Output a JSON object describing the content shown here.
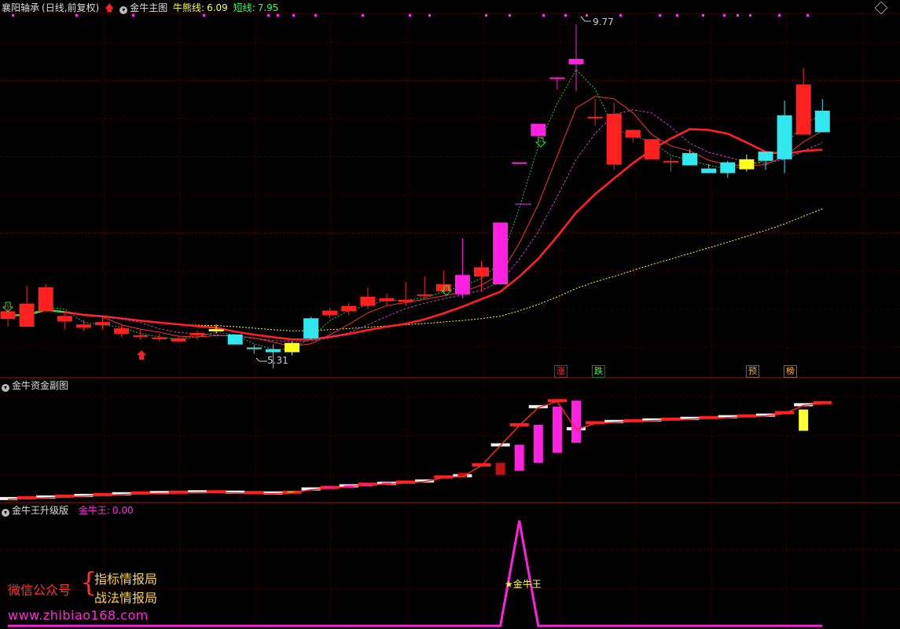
{
  "main_panel": {
    "stock_name": "襄阳轴承",
    "period": "(日线,前复权)",
    "indicator_name": "金牛主图",
    "bull_line_label": "牛熊线:",
    "bull_line_value": "6.09",
    "short_line_label": "短线:",
    "short_line_value": "7.95",
    "high_label": "9.77",
    "low_label": "5.31",
    "markers": [
      "涨",
      "跌",
      "预",
      "榜"
    ]
  },
  "sub_panel_1": {
    "title": "金牛资金副图"
  },
  "sub_panel_2": {
    "title": "金牛王升级版",
    "value_label": "金牛王:",
    "value": "0.00",
    "peak_label": "★金牛王"
  },
  "watermark": {
    "label": "微信公众号",
    "line1": "指标情报局",
    "line2": "战法情报局",
    "url": "www.zhibiao168.com"
  },
  "colors": {
    "up": "#ff2020",
    "down": "#30e8f0",
    "magenta": "#ff20e0",
    "yellow": "#ffff20",
    "grid": "#600000"
  },
  "chart_data": {
    "type": "candlestick",
    "candles": [
      {
        "o": 6.05,
        "c": 5.95,
        "h": 6.15,
        "l": 5.85,
        "color": "red"
      },
      {
        "o": 5.85,
        "c": 6.15,
        "h": 6.38,
        "l": 5.85,
        "color": "red"
      },
      {
        "o": 6.05,
        "c": 6.36,
        "h": 6.4,
        "l": 6.05,
        "color": "red"
      },
      {
        "o": 5.99,
        "c": 5.92,
        "h": 6.05,
        "l": 5.82,
        "color": "red"
      },
      {
        "o": 5.88,
        "c": 5.84,
        "h": 5.94,
        "l": 5.8,
        "color": "red"
      },
      {
        "o": 5.87,
        "c": 5.91,
        "h": 5.98,
        "l": 5.82,
        "color": "red"
      },
      {
        "o": 5.83,
        "c": 5.76,
        "h": 5.88,
        "l": 5.72,
        "color": "red"
      },
      {
        "o": 5.74,
        "c": 5.72,
        "h": 5.82,
        "l": 5.68,
        "color": "red"
      },
      {
        "o": 5.71,
        "c": 5.7,
        "h": 5.76,
        "l": 5.66,
        "color": "red"
      },
      {
        "o": 5.7,
        "c": 5.66,
        "h": 5.74,
        "l": 5.64,
        "color": "red"
      },
      {
        "o": 5.74,
        "c": 5.77,
        "h": 5.8,
        "l": 5.68,
        "color": "red"
      },
      {
        "o": 5.79,
        "c": 5.82,
        "h": 5.88,
        "l": 5.76,
        "color": "yellow"
      },
      {
        "o": 5.75,
        "c": 5.62,
        "h": 5.75,
        "l": 5.62,
        "color": "cyan"
      },
      {
        "o": 5.58,
        "c": 5.57,
        "h": 5.62,
        "l": 5.5,
        "color": "cyan"
      },
      {
        "o": 5.56,
        "c": 5.52,
        "h": 5.62,
        "l": 5.31,
        "color": "cyan"
      },
      {
        "o": 5.52,
        "c": 5.64,
        "h": 5.66,
        "l": 5.48,
        "color": "yellow"
      },
      {
        "o": 5.96,
        "c": 5.7,
        "h": 5.98,
        "l": 5.68,
        "color": "cyan"
      },
      {
        "o": 6.0,
        "c": 6.06,
        "h": 6.1,
        "l": 5.96,
        "color": "red"
      },
      {
        "o": 6.05,
        "c": 6.12,
        "h": 6.16,
        "l": 6.0,
        "color": "red"
      },
      {
        "o": 6.12,
        "c": 6.24,
        "h": 6.36,
        "l": 6.08,
        "color": "red"
      },
      {
        "o": 6.18,
        "c": 6.22,
        "h": 6.28,
        "l": 6.12,
        "color": "red"
      },
      {
        "o": 6.2,
        "c": 6.17,
        "h": 6.43,
        "l": 6.12,
        "color": "red"
      },
      {
        "o": 6.25,
        "c": 6.27,
        "h": 6.5,
        "l": 6.22,
        "color": "red"
      },
      {
        "o": 6.31,
        "c": 6.4,
        "h": 6.58,
        "l": 6.28,
        "color": "red"
      },
      {
        "o": 6.27,
        "c": 6.52,
        "h": 7.0,
        "l": 6.22,
        "color": "magenta"
      },
      {
        "o": 6.5,
        "c": 6.62,
        "h": 6.7,
        "l": 6.3,
        "color": "red"
      },
      {
        "o": 6.4,
        "c": 7.2,
        "h": 7.2,
        "l": 6.4,
        "color": "magenta"
      },
      {
        "o": 7.98,
        "c": 7.98,
        "h": 7.98,
        "l": 7.98,
        "color": "magenta"
      },
      {
        "o": 8.48,
        "c": 8.32,
        "h": 8.48,
        "l": 8.25,
        "color": "magenta"
      },
      {
        "o": 9.08,
        "c": 9.08,
        "h": 9.08,
        "l": 8.92,
        "color": "magenta"
      },
      {
        "o": 9.32,
        "c": 9.25,
        "h": 9.77,
        "l": 8.9,
        "color": "magenta"
      },
      {
        "o": 8.57,
        "c": 8.57,
        "h": 8.8,
        "l": 8.45,
        "color": "red"
      },
      {
        "o": 8.61,
        "c": 7.95,
        "h": 8.75,
        "l": 7.88,
        "color": "red"
      },
      {
        "o": 8.4,
        "c": 8.3,
        "h": 8.4,
        "l": 8.24,
        "color": "red"
      },
      {
        "o": 8.28,
        "c": 8.02,
        "h": 8.28,
        "l": 8.02,
        "color": "red"
      },
      {
        "o": 8.0,
        "c": 7.98,
        "h": 8.05,
        "l": 7.86,
        "color": "red"
      },
      {
        "o": 7.94,
        "c": 8.1,
        "h": 8.15,
        "l": 7.94,
        "color": "cyan"
      },
      {
        "o": 7.9,
        "c": 7.84,
        "h": 7.96,
        "l": 7.84,
        "color": "cyan"
      },
      {
        "o": 7.98,
        "c": 7.84,
        "h": 8.0,
        "l": 7.78,
        "color": "cyan"
      },
      {
        "o": 7.89,
        "c": 8.02,
        "h": 8.08,
        "l": 7.86,
        "color": "yellow"
      },
      {
        "o": 8.12,
        "c": 8.0,
        "h": 8.12,
        "l": 7.88,
        "color": "cyan"
      },
      {
        "o": 8.59,
        "c": 8.02,
        "h": 8.78,
        "l": 7.84,
        "color": "cyan"
      },
      {
        "o": 8.99,
        "c": 8.34,
        "h": 9.2,
        "l": 8.34,
        "color": "red"
      },
      {
        "o": 8.65,
        "c": 8.37,
        "h": 8.8,
        "l": 8.37,
        "color": "cyan"
      }
    ],
    "sub1_bars": [
      {
        "v": 0.6,
        "color": "#d8d8d8"
      },
      {
        "v": 0.8,
        "color": "#ff3030"
      },
      {
        "v": 1.0,
        "color": "#d8d8d8"
      },
      {
        "v": 1.2,
        "color": "#ff3030"
      },
      {
        "v": 1.4,
        "color": "#d8d8d8"
      },
      {
        "v": 1.6,
        "color": "#ff3030"
      },
      {
        "v": 1.8,
        "color": "#d8d8d8"
      },
      {
        "v": 2.0,
        "color": "#ff3030"
      },
      {
        "v": 2.1,
        "color": "#20c040"
      },
      {
        "v": 2.2,
        "color": "#d8d8d8"
      },
      {
        "v": 2.3,
        "color": "#ff3030"
      },
      {
        "v": 2.3,
        "color": "#d8d8d8"
      },
      {
        "v": 2.2,
        "color": "#20c040"
      },
      {
        "v": 2.1,
        "color": "#20c040"
      },
      {
        "v": 2.0,
        "color": "#d8d8d8"
      },
      {
        "v": 2.2,
        "color": "#ffff30"
      },
      {
        "v": 3.0,
        "color": "#ff20e0"
      },
      {
        "v": 3.4,
        "color": "#ff20e0"
      },
      {
        "v": 3.8,
        "color": "#ff20e0"
      },
      {
        "v": 4.2,
        "color": "#ff20e0"
      },
      {
        "v": 4.4,
        "color": "#d8d8d8"
      },
      {
        "v": 4.7,
        "color": "#d8d8d8"
      },
      {
        "v": 5.0,
        "color": "#d8d8d8"
      },
      {
        "v": 6.0,
        "color": "#c01010"
      },
      {
        "v": 6.3,
        "color": "#d8d8d8"
      },
      {
        "v": 9.0,
        "color": "#c01010"
      },
      {
        "v": 14.0,
        "color": "#ff20e0"
      },
      {
        "v": 19.0,
        "color": "#ff20e0"
      },
      {
        "v": 23.5,
        "color": "#ff20e0"
      },
      {
        "v": 25.0,
        "color": "#ff20e0"
      },
      {
        "v": 18.0,
        "color": "#d8d8d8"
      },
      {
        "v": 19.5,
        "color": "#d8d8d8"
      },
      {
        "v": 19.8,
        "color": "#d8d8d8"
      },
      {
        "v": 20.0,
        "color": "#d8d8d8"
      },
      {
        "v": 20.2,
        "color": "#d8d8d8"
      },
      {
        "v": 20.4,
        "color": "#d8d8d8"
      },
      {
        "v": 20.6,
        "color": "#d8d8d8"
      },
      {
        "v": 20.8,
        "color": "#d8d8d8"
      },
      {
        "v": 21.0,
        "color": "#d8d8d8"
      },
      {
        "v": 21.2,
        "color": "#d8d8d8"
      },
      {
        "v": 21.4,
        "color": "#d8d8d8"
      },
      {
        "v": 22.0,
        "color": "#d8d8d8"
      },
      {
        "v": 24.0,
        "color": "#ffff30"
      },
      {
        "v": 24.5,
        "color": "#d8d8d8"
      }
    ],
    "sub2_line": [
      0,
      0,
      0,
      0,
      0,
      0,
      0,
      0,
      0,
      0,
      0,
      0,
      0,
      0,
      0,
      0,
      0,
      0,
      0,
      0,
      0,
      0,
      0,
      0,
      0,
      0,
      0,
      1,
      0,
      0,
      0,
      0,
      0,
      0,
      0,
      0,
      0,
      0,
      0,
      0,
      0,
      0,
      0,
      0
    ]
  }
}
